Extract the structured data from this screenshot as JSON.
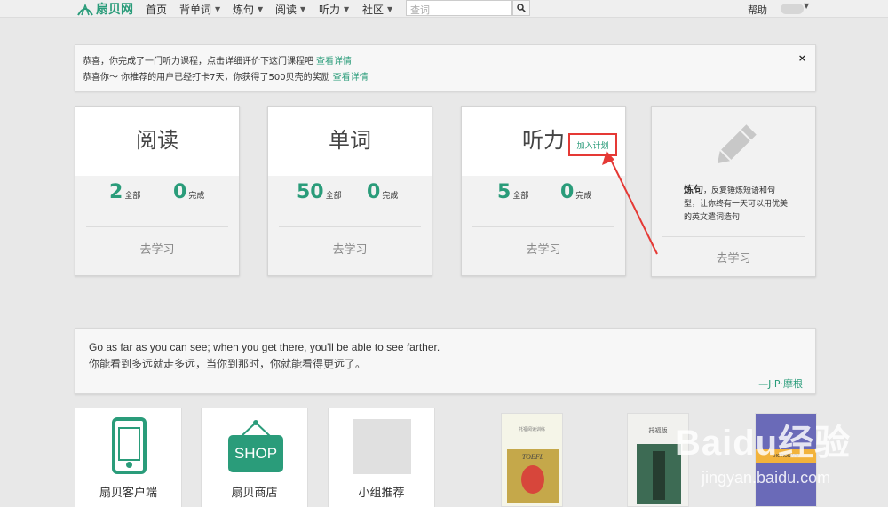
{
  "nav": {
    "brand": "扇贝网",
    "home": "首页",
    "menus": [
      "背单词",
      "炼句",
      "阅读",
      "听力",
      "社区"
    ],
    "search_placeholder": "查词",
    "help": "帮助"
  },
  "notice": {
    "line1_text": "恭喜，你完成了一门听力课程，点击详细评价下这门课程吧",
    "line1_link": "查看详情",
    "line2_text": "恭喜你～ 你推荐的用户已经打卡7天，你获得了500贝壳的奖励",
    "line2_link": "查看详情",
    "close": "×"
  },
  "cards": [
    {
      "title": "阅读",
      "total": "2",
      "total_label": "全部",
      "done": "0",
      "done_label": "完成",
      "action": "去学习"
    },
    {
      "title": "单词",
      "total": "50",
      "total_label": "全部",
      "done": "0",
      "done_label": "完成",
      "action": "去学习"
    },
    {
      "title": "听力",
      "total": "5",
      "total_label": "全部",
      "done": "0",
      "done_label": "完成",
      "action": "去学习",
      "add_plan": "加入计划"
    }
  ],
  "card4": {
    "title": "炼句",
    "desc": "，反复锤炼短语和句型，让你终有一天可以用优美的英文遣词造句",
    "action": "去学习"
  },
  "quote": {
    "en": "Go as far as you can see; when you get there, you'll be able to see farther.",
    "zh": "你能看到多远就走多远，当你到那时，你就能看得更远了。",
    "author": "—J·P·摩根"
  },
  "tiles": [
    {
      "label": "扇贝客户端",
      "icon": "phone-icon"
    },
    {
      "label": "扇贝商店",
      "icon": "shop-icon",
      "sign": "SHOP"
    },
    {
      "label": "小组推荐",
      "icon": "group-icon"
    }
  ],
  "books": {
    "book1_title": "托福阅读训练",
    "book1_cover": "TOEFL",
    "book2_title": "托福版",
    "book3_title": "DICTIONARY"
  },
  "watermark": {
    "main": "Baidu经验",
    "sub": "jingyan.baidu.com"
  },
  "colors": {
    "accent": "#2a9c7a",
    "highlight": "#e53935"
  }
}
